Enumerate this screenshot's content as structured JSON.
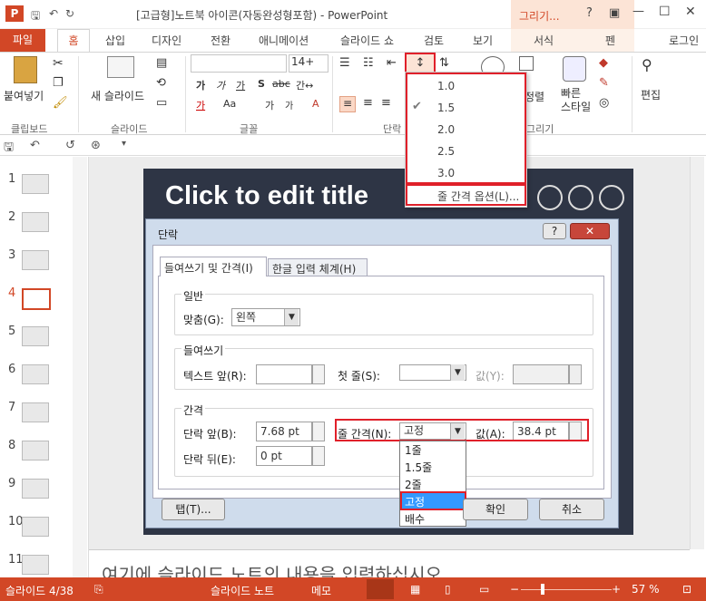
{
  "titlebar": {
    "logo": "P",
    "title": "[고급형]노트북 아이콘(자동완성형포함) - PowerPoint",
    "context_tool": "그리기...",
    "controls": [
      "?",
      "▣",
      "—",
      "☐",
      "✕"
    ]
  },
  "tabs": {
    "file": "파일",
    "home": "홈",
    "items": [
      "삽입",
      "디자인",
      "전환",
      "애니메이션",
      "슬라이드 쇼",
      "검토",
      "보기"
    ],
    "ctx_format": "서식",
    "ctx_pen": "펜",
    "login": "로그인"
  },
  "ribbon": {
    "clipboard": {
      "paste": "붙여넣기",
      "label": "클립보드"
    },
    "slides": {
      "new_slide": "새 슬라이드",
      "label": "슬라이드"
    },
    "font": {
      "name": "",
      "size": "14+",
      "bold": "가",
      "italic": "가",
      "underline": "가",
      "shadow": "S",
      "strike": "abc",
      "spacing": "간↔",
      "grow": "가",
      "shrink": "가",
      "clear": "A",
      "color": "가",
      "case": "Aa",
      "label": "글꼴"
    },
    "paragraph": {
      "label": "단락"
    },
    "drawing": {
      "arrange": "정렬",
      "quick_style": "빠른\n스타일",
      "label": "그리기"
    },
    "editing": {
      "label": "편집"
    }
  },
  "line_spacing_menu": {
    "options": [
      "1.0",
      "1.5",
      "2.0",
      "2.5",
      "3.0"
    ],
    "checked": "1.5",
    "more": "줄 간격 옵션(L)..."
  },
  "thumbnails": [
    "1",
    "2",
    "3",
    "4",
    "5",
    "6",
    "7",
    "8",
    "9",
    "10",
    "11"
  ],
  "active_slide": "4",
  "slide": {
    "title": "Click to edit title"
  },
  "notes": {
    "placeholder": "여기에 슬라이드 노트의 내용을 입력하십시오"
  },
  "dialog": {
    "title": "단락",
    "tab_indent": "들여쓰기 및 간격(I)",
    "tab_korean": "한글 입력 체계(H)",
    "general": {
      "label": "일반",
      "align_label": "맞춤(G):",
      "align_value": "왼쪽"
    },
    "indent": {
      "label": "들여쓰기",
      "before_text_label": "텍스트 앞(R):",
      "before_text_value": "",
      "first_line_label": "첫 줄(S):",
      "first_line_value": "",
      "by_label": "값(Y):",
      "by_value": ""
    },
    "spacing": {
      "label": "간격",
      "before_label": "단락 앞(B):",
      "before_value": "7.68 pt",
      "after_label": "단락 뒤(E):",
      "after_value": "0 pt",
      "line_spacing_label": "줄 간격(N):",
      "line_spacing_value": "고정",
      "at_label": "값(A):",
      "at_value": "38.4 pt"
    },
    "line_spacing_options": [
      "1줄",
      "1.5줄",
      "2줄",
      "고정",
      "배수"
    ],
    "selected_option": "고정",
    "tabs_button": "탭(T)...",
    "ok_button": "확인",
    "cancel_button": "취소"
  },
  "status": {
    "slide": "슬라이드 4/38",
    "notes": "슬라이드 노트",
    "comments": "메모",
    "zoom": "57 %"
  }
}
